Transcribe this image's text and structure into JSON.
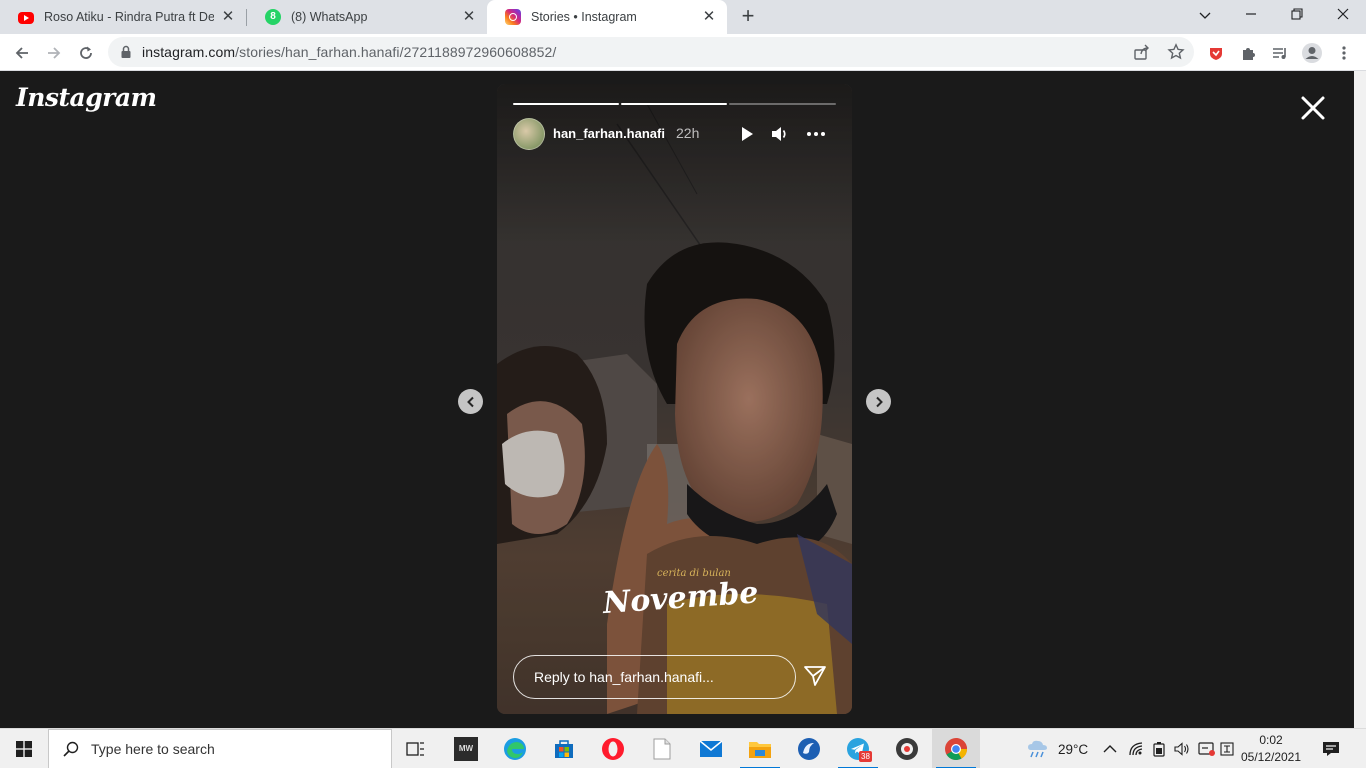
{
  "browser": {
    "tabs": [
      {
        "title": "Roso Atiku - Rindra Putra ft Desty",
        "favicon": "youtube-icon",
        "active": false
      },
      {
        "title": "(8) WhatsApp",
        "favicon": "whatsapp-icon",
        "badge": "8",
        "active": false
      },
      {
        "title": "Stories • Instagram",
        "favicon": "instagram-icon",
        "active": true
      }
    ],
    "url_host": "instagram.com",
    "url_path": "/stories/han_farhan.hanafi/2721188972960608852/"
  },
  "instagram": {
    "logo": "Instagram",
    "story": {
      "username": "han_farhan.hanafi",
      "time": "22h",
      "progress": [
        1.0,
        1.0,
        0.0,
        0.0
      ],
      "sticker_small": "cerita di bulan",
      "sticker_main": "November",
      "reply_placeholder": "Reply to han_farhan.hanafi..."
    }
  },
  "taskbar": {
    "search_placeholder": "Type here to search",
    "apps": [
      "task-view-icon",
      "mw-app-icon",
      "edge-icon",
      "store-icon",
      "opera-icon",
      "notepad-icon",
      "mail-icon",
      "file-explorer-icon",
      "browser-icon",
      "telegram-icon",
      "media-player-icon",
      "chrome-icon"
    ],
    "telegram_badge": "38",
    "weather": "29°C",
    "time": "0:02",
    "date": "05/12/2021"
  },
  "colors": {
    "page_bg": "#1a1a1a",
    "tab_strip": "#dee1e6",
    "taskbar": "#f0f0f0",
    "accent": "#0078d7"
  }
}
